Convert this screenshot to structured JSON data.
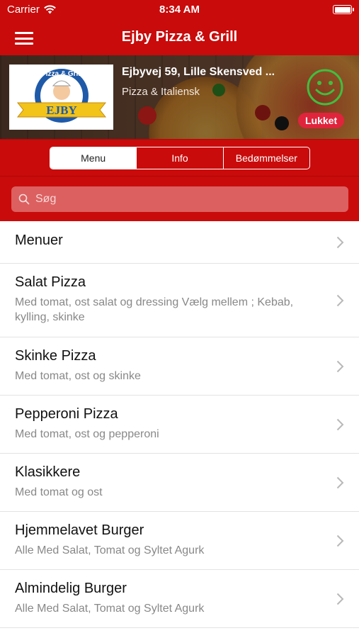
{
  "status_bar": {
    "carrier": "Carrier",
    "time": "8:34 AM"
  },
  "nav": {
    "title": "Ejby Pizza & Grill"
  },
  "restaurant": {
    "logo_text_top": "Pizza & Grill",
    "logo_text_banner": "EJBY",
    "address": "Ejbyvej 59, Lille Skensved ...",
    "category": "Pizza & Italiensk",
    "open_status": "Lukket"
  },
  "tabs": [
    {
      "label": "Menu",
      "active": true
    },
    {
      "label": "Info",
      "active": false
    },
    {
      "label": "Bedømmelser",
      "active": false
    }
  ],
  "search": {
    "placeholder": "Søg"
  },
  "menu_items": [
    {
      "title": "Menuer",
      "description": ""
    },
    {
      "title": "Salat Pizza",
      "description": "Med tomat, ost salat og dressing Vælg mellem ; Kebab, kylling, skinke"
    },
    {
      "title": "Skinke Pizza",
      "description": "Med tomat, ost og skinke"
    },
    {
      "title": "Pepperoni Pizza",
      "description": "Med tomat, ost og pepperoni"
    },
    {
      "title": "Klasikkere",
      "description": "Med tomat og ost"
    },
    {
      "title": "Hjemmelavet Burger",
      "description": "Alle Med Salat, Tomat og Syltet Agurk"
    },
    {
      "title": "Almindelig Burger",
      "description": "Alle Med Salat, Tomat og Syltet Agurk"
    }
  ],
  "colors": {
    "brand_red": "#c90b0b",
    "smile_green": "#3fbf3f",
    "closed_badge": "#e0243c"
  }
}
